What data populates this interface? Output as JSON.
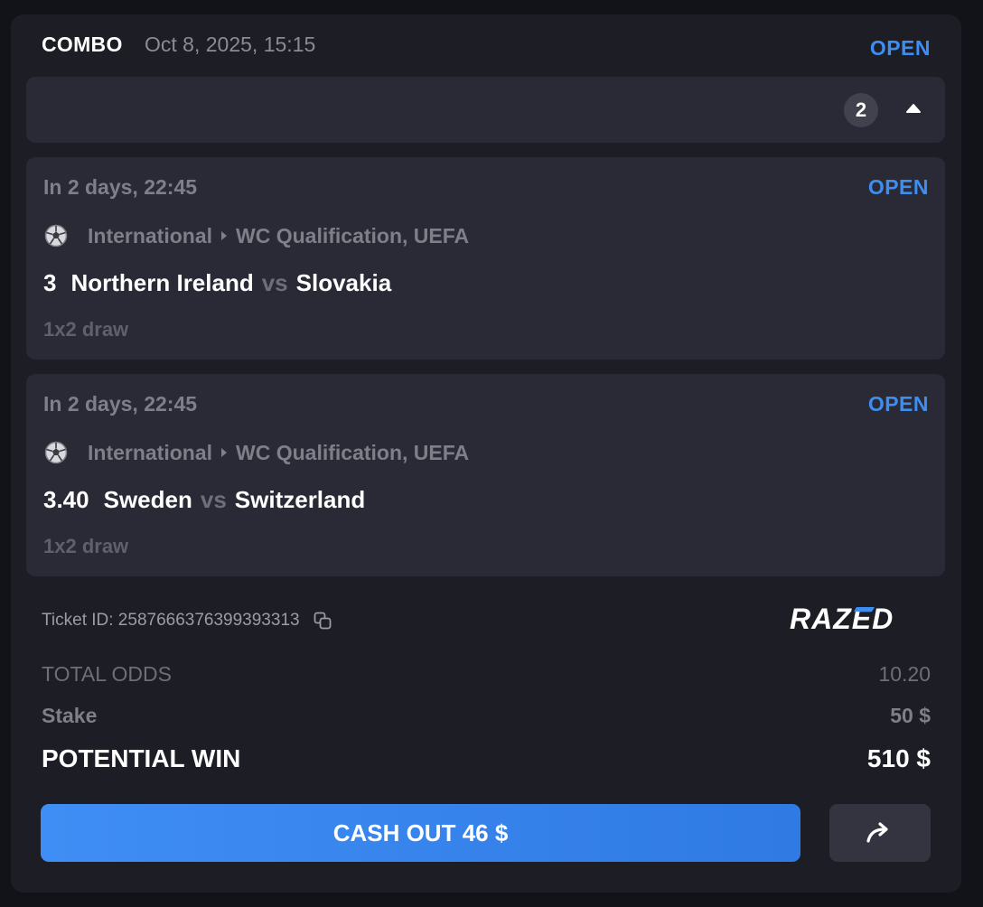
{
  "bet": {
    "type": "COMBO",
    "date": "Oct 8, 2025, 15:15",
    "status": "OPEN",
    "selection_count": "2"
  },
  "selections": [
    {
      "time": "In 2 days, 22:45",
      "status": "OPEN",
      "sport_icon": "soccer-ball-icon",
      "category": "International",
      "league": "WC Qualification, UEFA",
      "odds": "3",
      "home": "Northern Ireland",
      "vs": "vs",
      "away": "Slovakia",
      "market": "1x2 draw"
    },
    {
      "time": "In 2 days, 22:45",
      "status": "OPEN",
      "sport_icon": "soccer-ball-icon",
      "category": "International",
      "league": "WC Qualification, UEFA",
      "odds": "3.40",
      "home": "Sweden",
      "vs": "vs",
      "away": "Switzerland",
      "market": "1x2 draw"
    }
  ],
  "ticket": {
    "label": "Ticket ID: 2587666376399393313",
    "brand": "RAZED"
  },
  "totals": {
    "odds_label": "TOTAL ODDS",
    "odds_value": "10.20",
    "stake_label": "Stake",
    "stake_value": "50 $",
    "win_label": "POTENTIAL WIN",
    "win_value": "510 $"
  },
  "actions": {
    "cashout_label": "CASH OUT 46 $",
    "share_icon": "share-arrow-icon"
  },
  "colors": {
    "accent": "#3d8ef0",
    "card_bg": "#1c1d25",
    "panel_bg": "#292a35"
  }
}
